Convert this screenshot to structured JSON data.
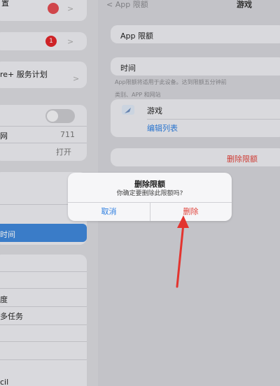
{
  "left_panel": {
    "top_row_label": "置",
    "update_badge": "1",
    "care_row_label": "re+ 服务计划",
    "row_711_label": "网",
    "row_711_value": "711",
    "row_open_label": "",
    "row_open_value": "打开",
    "selected_item_label": "时间",
    "item_1_label": "度",
    "item_2_label": "多任务",
    "item_bottom_label": "cil"
  },
  "right_panel": {
    "back_label": "App 限额",
    "nav_title": "游戏",
    "app_limit_label": "App 限额",
    "time_label": "时间",
    "footnote_line1": "App限额将适用于此设备。达到限额五分钟前",
    "footnote_line2": "类别、APP 和网站",
    "category_label": "游戏",
    "edit_list_label": "编辑列表",
    "delete_limit_label": "删除限额"
  },
  "alert": {
    "title": "删除限额",
    "message": "你确定要删除此限额吗?",
    "cancel_label": "取消",
    "delete_label": "删除"
  },
  "icons": {
    "back": "chevron-left-icon",
    "category": "rocket-icon",
    "chevron": "chevron-right-icon"
  },
  "colors": {
    "accent": "#2f7fe0",
    "destructive": "#e0433b",
    "selected_bg": "#3f87d9",
    "annotation_arrow": "#e3342f"
  }
}
